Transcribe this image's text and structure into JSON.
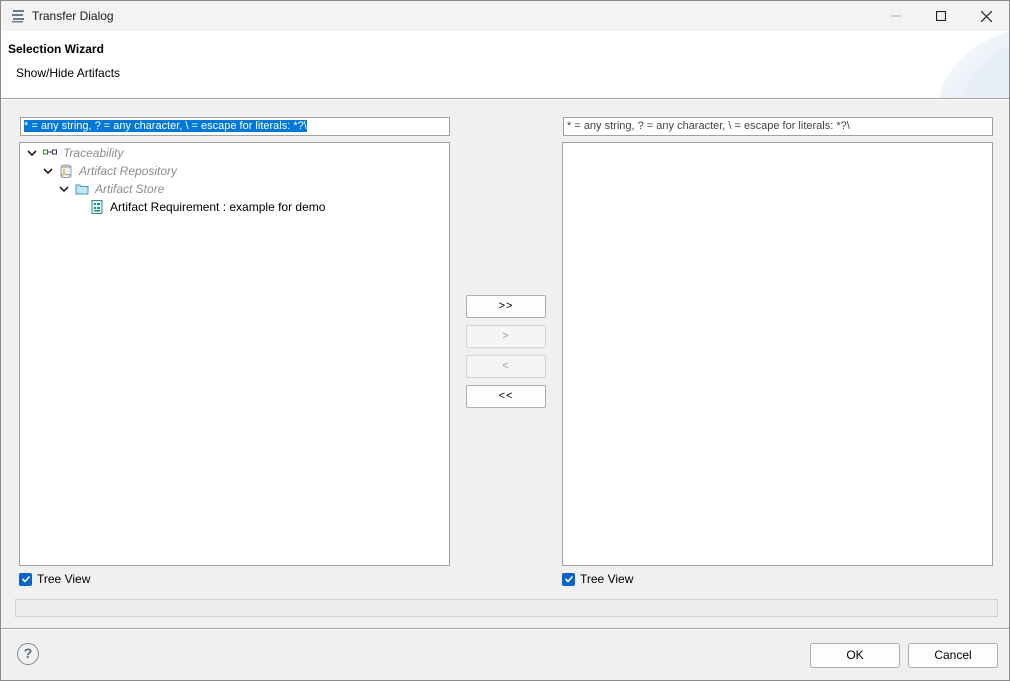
{
  "window": {
    "title": "Transfer Dialog"
  },
  "header": {
    "title": "Selection Wizard",
    "subtitle": "Show/Hide Artifacts"
  },
  "left": {
    "filter_value": "* = any string, ? = any character, \\ = escape for literals: *?\\",
    "tree": [
      {
        "label": "Traceability",
        "icon": "traceability-icon"
      },
      {
        "label": "Artifact Repository",
        "icon": "repository-icon"
      },
      {
        "label": "Artifact Store",
        "icon": "folder-icon"
      },
      {
        "label": "Artifact Requirement : example for demo",
        "icon": "requirement-icon"
      }
    ],
    "tree_view_label": "Tree View"
  },
  "right": {
    "filter_value": "* = any string, ? = any character, \\ = escape for literals: *?\\",
    "tree_view_label": "Tree View"
  },
  "transfer": {
    "add_all": ">>",
    "add": ">",
    "remove": "<",
    "remove_all": "<<"
  },
  "footer": {
    "help": "?",
    "ok": "OK",
    "cancel": "Cancel"
  },
  "colors": {
    "selection": "#0078d7",
    "checkbox": "#0a64c8"
  }
}
